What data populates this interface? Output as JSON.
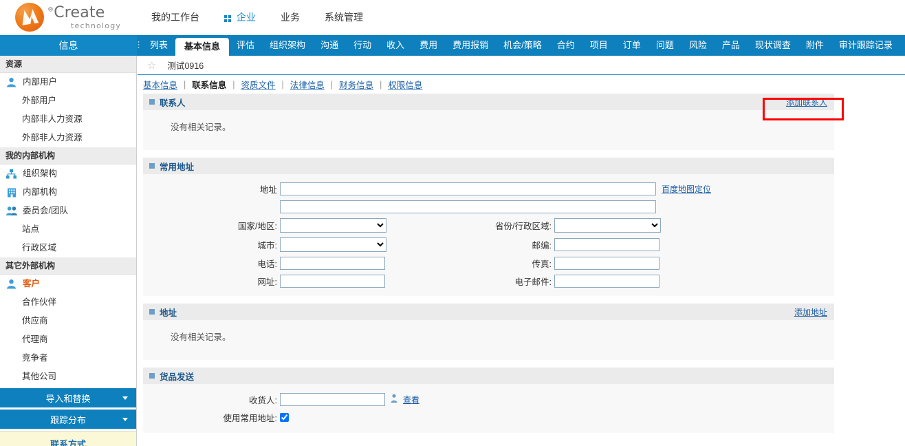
{
  "brand": {
    "name": "Create",
    "registered": "®",
    "tagline": "technology"
  },
  "mainnav": {
    "items": [
      {
        "label": "我的工作台",
        "active": false,
        "icon": ""
      },
      {
        "label": "企业",
        "active": true,
        "icon": "grid-icon"
      },
      {
        "label": "业务",
        "active": false,
        "icon": ""
      },
      {
        "label": "系统管理",
        "active": false,
        "icon": ""
      }
    ]
  },
  "leftpanel_label": "信息",
  "tabs": [
    {
      "label": "列表",
      "active": false
    },
    {
      "label": "基本信息",
      "active": true
    },
    {
      "label": "评估",
      "active": false
    },
    {
      "label": "组织架构",
      "active": false
    },
    {
      "label": "沟通",
      "active": false
    },
    {
      "label": "行动",
      "active": false
    },
    {
      "label": "收入",
      "active": false
    },
    {
      "label": "费用",
      "active": false
    },
    {
      "label": "费用报销",
      "active": false
    },
    {
      "label": "机会/策略",
      "active": false
    },
    {
      "label": "合约",
      "active": false
    },
    {
      "label": "项目",
      "active": false
    },
    {
      "label": "订单",
      "active": false
    },
    {
      "label": "问题",
      "active": false
    },
    {
      "label": "风险",
      "active": false
    },
    {
      "label": "产品",
      "active": false
    },
    {
      "label": "现状调查",
      "active": false
    },
    {
      "label": "附件",
      "active": false
    },
    {
      "label": "审计跟踪记录",
      "active": false
    }
  ],
  "sidebar": {
    "sections": [
      {
        "group": "资源",
        "items": [
          {
            "label": "内部用户",
            "icon": "user-icon",
            "nested": false,
            "hot": false
          },
          {
            "label": "外部用户",
            "icon": "",
            "nested": true,
            "hot": false
          },
          {
            "label": "内部非人力资源",
            "icon": "",
            "nested": true,
            "hot": false
          },
          {
            "label": "外部非人力资源",
            "icon": "",
            "nested": true,
            "hot": false
          }
        ]
      },
      {
        "group": "我的内部机构",
        "items": [
          {
            "label": "组织架构",
            "icon": "org-chart-icon",
            "nested": false,
            "hot": false
          },
          {
            "label": "内部机构",
            "icon": "building-icon",
            "nested": false,
            "hot": false
          },
          {
            "label": "委员会/团队",
            "icon": "users-icon",
            "nested": false,
            "hot": false
          },
          {
            "label": "站点",
            "icon": "",
            "nested": true,
            "hot": false
          },
          {
            "label": "行政区域",
            "icon": "",
            "nested": true,
            "hot": false
          }
        ]
      },
      {
        "group": "其它外部机构",
        "items": [
          {
            "label": "客户",
            "icon": "user-icon",
            "nested": false,
            "hot": true
          },
          {
            "label": "合作伙伴",
            "icon": "",
            "nested": true,
            "hot": false
          },
          {
            "label": "供应商",
            "icon": "",
            "nested": true,
            "hot": false
          },
          {
            "label": "代理商",
            "icon": "",
            "nested": true,
            "hot": false
          },
          {
            "label": "竞争者",
            "icon": "",
            "nested": true,
            "hot": false
          },
          {
            "label": "其他公司",
            "icon": "",
            "nested": true,
            "hot": false
          }
        ]
      }
    ],
    "buttons": [
      {
        "label": "导入和替换"
      },
      {
        "label": "跟踪分布"
      }
    ],
    "footer_partial": "联系方式"
  },
  "breadcrumb": {
    "star_icon": "star-icon",
    "title": "测试0916"
  },
  "subtabs": [
    {
      "label": "基本信息",
      "active": false
    },
    {
      "label": "联系信息",
      "active": true
    },
    {
      "label": "资质文件",
      "active": false
    },
    {
      "label": "法律信息",
      "active": false
    },
    {
      "label": "财务信息",
      "active": false
    },
    {
      "label": "权限信息",
      "active": false
    }
  ],
  "separator": "|",
  "panels": {
    "contacts": {
      "title": "联系人",
      "link": "添加联系人",
      "empty": "没有相关记录。"
    },
    "common_address": {
      "title": "常用地址",
      "fields": {
        "address_label": "地址",
        "address_value": "",
        "address2_value": "",
        "map_link": "百度地图定位",
        "country_label": "国家/地区:",
        "country_value": "",
        "province_label": "省份/行政区域:",
        "province_value": "",
        "city_label": "城市:",
        "city_value": "",
        "zip_label": "邮编:",
        "zip_value": "",
        "phone_label": "电话:",
        "phone_value": "",
        "fax_label": "传真:",
        "fax_value": "",
        "web_label": "网址:",
        "web_value": "",
        "email_label": "电子邮件:",
        "email_value": ""
      }
    },
    "address": {
      "title": "地址",
      "link": "添加地址",
      "empty": "没有相关记录。"
    },
    "shipping": {
      "title": "货品发送",
      "recipient_label": "收货人:",
      "recipient_value": "",
      "picker_icon": "person-picker-icon",
      "view_link": "查看",
      "use_common_label": "使用常用地址:",
      "use_common_checked": true
    }
  },
  "highlight": {
    "name": "red-highlight-box",
    "color": "#ff0000"
  },
  "colors": {
    "primary_blue": "#0e80bd",
    "panel_header": "#ebebeb",
    "link_blue": "#1b5fa8",
    "accent_orange": "#e2590b",
    "panel_title_blue": "#1e5a8e"
  }
}
